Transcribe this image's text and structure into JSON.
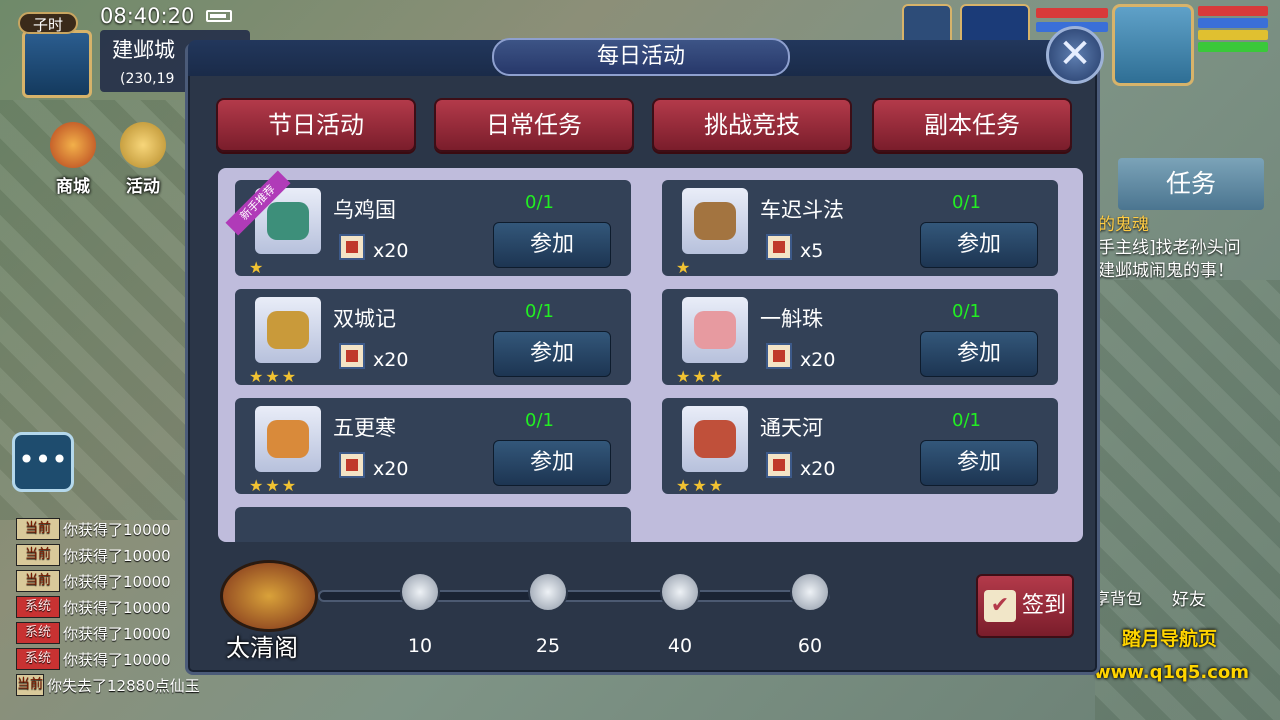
{
  "hud": {
    "time_slot": "子时",
    "clock": "08:40:20",
    "city": "建邺城",
    "coordinates": "(230,19"
  },
  "side_buttons": [
    {
      "label": "商城"
    },
    {
      "label": "活动"
    }
  ],
  "chat": [
    {
      "tag": "当前",
      "type": "now",
      "text": "你获得了10000"
    },
    {
      "tag": "当前",
      "type": "now",
      "text": "你获得了10000"
    },
    {
      "tag": "当前",
      "type": "now",
      "text": "你获得了10000"
    },
    {
      "tag": "系统",
      "type": "sys",
      "text": "你获得了10000"
    },
    {
      "tag": "系统",
      "type": "sys",
      "text": "你获得了10000"
    },
    {
      "tag": "系统",
      "type": "sys",
      "text": "你获得了10000"
    },
    {
      "tag": "当前",
      "type": "now",
      "text": "你失去了12880点仙玉"
    }
  ],
  "right": {
    "task_tab": "任务",
    "task_line1": "的鬼魂",
    "task_line2": "手主线]找老孙头问",
    "task_line3": "建邺城闹鬼的事！",
    "inventory_label": "享背包",
    "friends_label": "好友",
    "watermark_name": "踏月导航页",
    "watermark_url": "www.q1q5.com"
  },
  "panel": {
    "title": "每日活动",
    "close": "✕",
    "tabs": [
      "节日活动",
      "日常任务",
      "挑战竞技",
      "副本任务"
    ],
    "activities": [
      {
        "name": "乌鸡国",
        "progress": "0/1",
        "qty": "x20",
        "stars": 1,
        "button": "参加",
        "badge": "新手推荐",
        "icon_color": "#3d8f7a"
      },
      {
        "name": "车迟斗法",
        "progress": "0/1",
        "qty": "x5",
        "stars": 1,
        "button": "参加",
        "badge": "",
        "icon_color": "#a37440"
      },
      {
        "name": "双城记",
        "progress": "0/1",
        "qty": "x20",
        "stars": 3,
        "button": "参加",
        "badge": "",
        "icon_color": "#c99a3a"
      },
      {
        "name": "一斛珠",
        "progress": "0/1",
        "qty": "x20",
        "stars": 3,
        "button": "参加",
        "badge": "",
        "icon_color": "#e79aa0"
      },
      {
        "name": "五更寒",
        "progress": "0/1",
        "qty": "x20",
        "stars": 3,
        "button": "参加",
        "badge": "",
        "icon_color": "#d98a3a"
      },
      {
        "name": "通天河",
        "progress": "0/1",
        "qty": "x20",
        "stars": 3,
        "button": "参加",
        "badge": "",
        "icon_color": "#c0503a"
      }
    ],
    "pavilion_label": "太清阁",
    "milestones": [
      "10",
      "25",
      "40",
      "60"
    ],
    "signin_label": "签到"
  }
}
